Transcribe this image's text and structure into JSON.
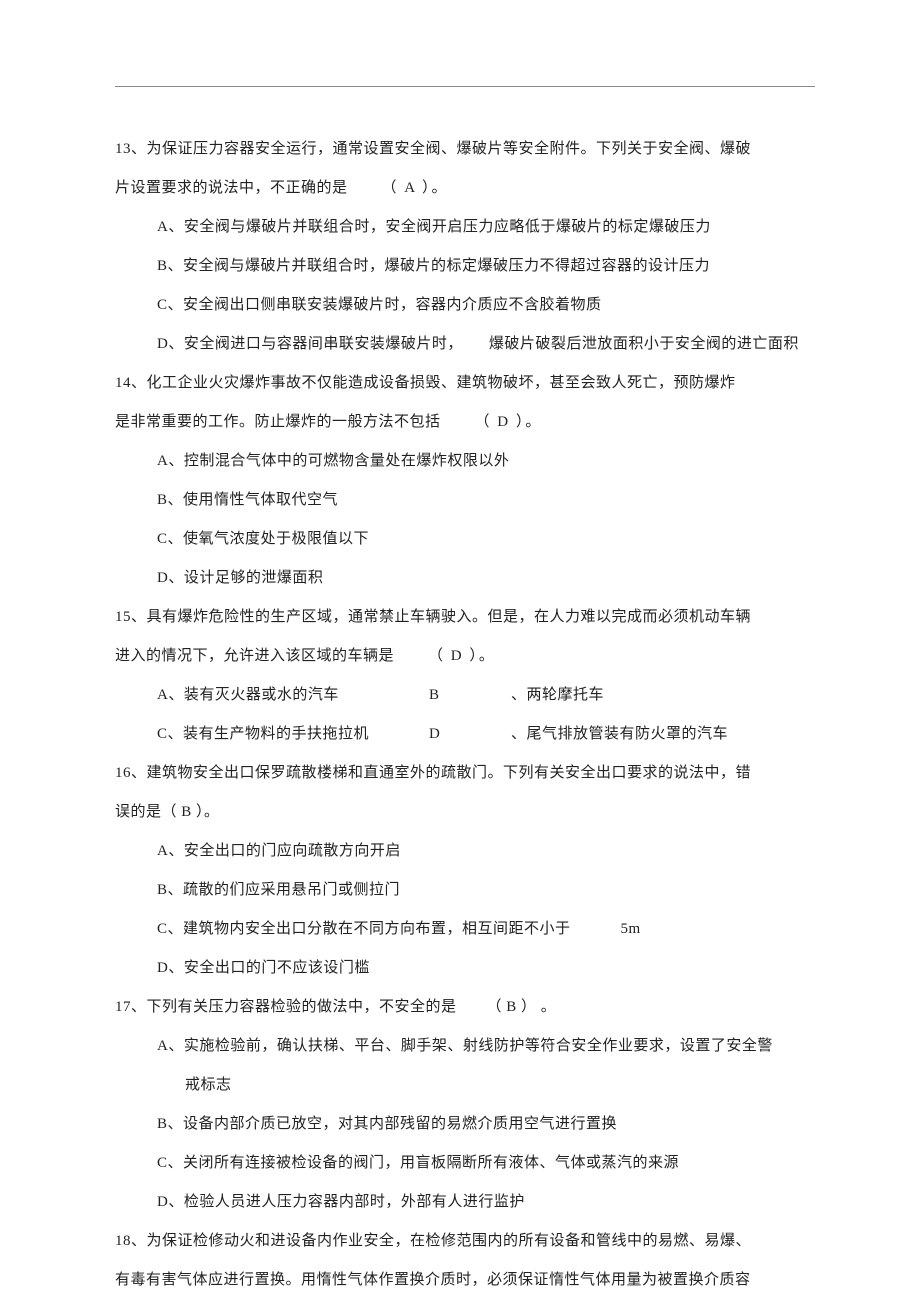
{
  "q13": {
    "stem_l1": "13、为保证压力容器安全运行，通常设置安全阀、爆破片等安全附件。下列关于安全阀、爆破",
    "stem_l2_a": "片设置要求的说法中，不正确的是",
    "ans": "（  A  ）。",
    "A": "A、安全阀与爆破片并联组合时，安全阀开启压力应略低于爆破片的标定爆破压力",
    "B": "B、安全阀与爆破片并联组合时，爆破片的标定爆破压力不得超过容器的设计压力",
    "C": "C、安全阀出口侧串联安装爆破片时，容器内介质应不含胶着物质",
    "D_a": "D、安全阀进口与容器间串联安装爆破片时，",
    "D_b": "爆破片破裂后泄放面积小于安全阀的进亡面积"
  },
  "q14": {
    "stem_l1": "14、化工企业火灾爆炸事故不仅能造成设备损毁、建筑物破坏，甚至会致人死亡，预防爆炸",
    "stem_l2_a": "是非常重要的工作。防止爆炸的一般方法不包括",
    "ans": "（  D  ）。",
    "A": "A、控制混合气体中的可燃物含量处在爆炸权限以外",
    "B": "B、使用惰性气体取代空气",
    "C": "C、使氧气浓度处于极限值以下",
    "D": "D、设计足够的泄爆面积"
  },
  "q15": {
    "stem_l1": "15、具有爆炸危险性的生产区域，通常禁止车辆驶入。但是，在人力难以完成而必须机动车辆",
    "stem_l2_a": "进入的情况下，允许进入该区域的车辆是",
    "ans": "（  D  ）。",
    "A": "A、装有灭火器或水的汽车",
    "B_lbl": "B",
    "B_txt": "、两轮摩托车",
    "C": "C、装有生产物料的手扶拖拉机",
    "D_lbl": "D",
    "D_txt": "、尾气排放管装有防火罩的汽车"
  },
  "q16": {
    "stem_l1": "16、建筑物安全出口保罗疏散楼梯和直通室外的疏散门。下列有关安全出口要求的说法中，错",
    "stem_l2": "误的是（ B ）。",
    "A": "A、安全出口的门应向疏散方向开启",
    "B": "B、疏散的们应采用悬吊门或侧拉门",
    "C_a": "C、建筑物内安全出口分散在不同方向布置，相互间距不小于",
    "C_b": "5m",
    "D": "D、安全出口的门不应该设门槛"
  },
  "q17": {
    "stem_a": "17、下列有关压力容器检验的做法中，不安全的是",
    "ans": "（ B ） 。",
    "A1": "A、实施检验前，确认扶梯、平台、脚手架、射线防护等符合安全作业要求，设置了安全警",
    "A2": "戒标志",
    "B": "B、设备内部介质已放空，对其内部残留的易燃介质用空气进行置换",
    "C": "C、关闭所有连接被检设备的阀门，用盲板隔断所有液体、气体或蒸汽的来源",
    "D": "D、检验人员进人压力容器内部时，外部有人进行监护"
  },
  "q18": {
    "l1": "18、为保证检修动火和进设备内作业安全，在检修范围内的所有设备和管线中的易燃、易爆、",
    "l2": "有毒有害气体应进行置换。用惰性气体作置换介质时，必须保证惰性气体用量为被置换介质容"
  }
}
